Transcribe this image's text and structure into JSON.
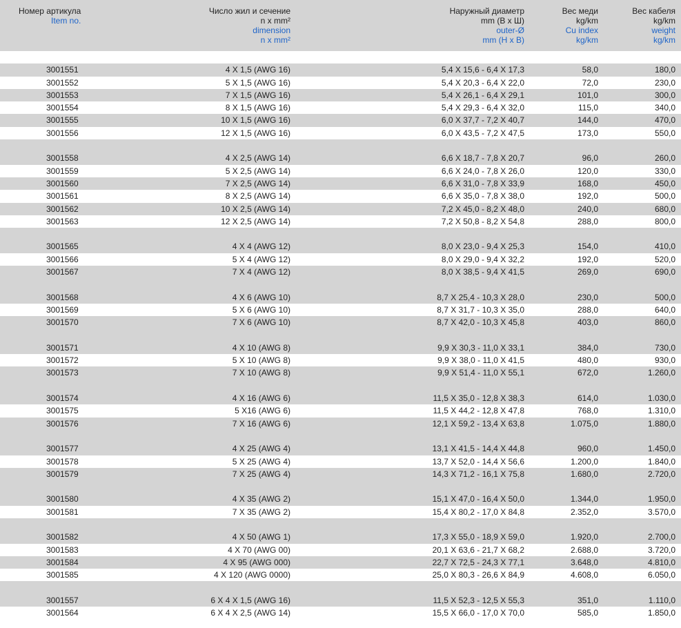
{
  "header": {
    "col1": {
      "ru": "Номер артикула",
      "en": "Item no."
    },
    "col2": {
      "ru1": "Число жил и сечение",
      "ru2": "n x mm²",
      "en1": "dimension",
      "en2": "n x mm²"
    },
    "col3": {
      "ru1": "Наружный диаметр",
      "ru2": "mm (В x Ш)",
      "en1": "outer-Ø",
      "en2": "mm (H x B)"
    },
    "col4": {
      "ru1": "Вес меди",
      "ru2": "kg/km",
      "en1": "Cu index",
      "en2": "kg/km"
    },
    "col5": {
      "ru1": "Вес кабеля",
      "ru2": "kg/km",
      "en1": "weight",
      "en2": "kg/km"
    }
  },
  "colors": {
    "stripe": "#d4d4d4",
    "accent_blue": "#1e64c8"
  },
  "groups": [
    [
      [
        "3001551",
        "4 X 1,5 (AWG 16)",
        "5,4 X 15,6 - 6,4 X 17,3",
        "58,0",
        "180,0"
      ],
      [
        "3001552",
        "5 X 1,5 (AWG 16)",
        "5,4 X 20,3 - 6,4 X 22,0",
        "72,0",
        "230,0"
      ],
      [
        "3001553",
        "7 X 1,5 (AWG 16)",
        "5,4 X 26,1 - 6,4 X 29,1",
        "101,0",
        "300,0"
      ],
      [
        "3001554",
        "8 X 1,5 (AWG 16)",
        "5,4 X 29,3 - 6,4 X 32,0",
        "115,0",
        "340,0"
      ],
      [
        "3001555",
        "10 X 1,5 (AWG 16)",
        "6,0 X 37,7 - 7,2 X 40,7",
        "144,0",
        "470,0"
      ],
      [
        "3001556",
        "12 X 1,5 (AWG 16)",
        "6,0 X 43,5 - 7,2 X 47,5",
        "173,0",
        "550,0"
      ]
    ],
    [
      [
        "3001558",
        "4 X 2,5 (AWG 14)",
        "6,6 X 18,7 - 7,8 X 20,7",
        "96,0",
        "260,0"
      ],
      [
        "3001559",
        "5 X 2,5 (AWG 14)",
        "6,6 X 24,0 - 7,8 X 26,0",
        "120,0",
        "330,0"
      ],
      [
        "3001560",
        "7 X 2,5 (AWG 14)",
        "6,6 X 31,0 - 7,8 X 33,9",
        "168,0",
        "450,0"
      ],
      [
        "3001561",
        "8 X 2,5 (AWG 14)",
        "6,6 X 35,0 - 7,8 X 38,0",
        "192,0",
        "500,0"
      ],
      [
        "3001562",
        "10 X 2,5 (AWG 14)",
        "7,2 X 45,0 - 8,2 X 48,0",
        "240,0",
        "680,0"
      ],
      [
        "3001563",
        "12 X 2,5 (AWG 14)",
        "7,2 X 50,8 - 8,2 X 54,8",
        "288,0",
        "800,0"
      ]
    ],
    [
      [
        "3001565",
        "4 X 4 (AWG 12)",
        "8,0 X 23,0 - 9,4 X 25,3",
        "154,0",
        "410,0"
      ],
      [
        "3001566",
        "5 X 4 (AWG 12)",
        "8,0 X 29,0 - 9,4 X 32,2",
        "192,0",
        "520,0"
      ],
      [
        "3001567",
        "7 X 4 (AWG 12)",
        "8,0 X 38,5 - 9,4 X 41,5",
        "269,0",
        "690,0"
      ]
    ],
    [
      [
        "3001568",
        "4 X 6 (AWG 10)",
        "8,7 X 25,4 - 10,3 X 28,0",
        "230,0",
        "500,0"
      ],
      [
        "3001569",
        "5 X 6 (AWG 10)",
        "8,7 X 31,7 - 10,3 X 35,0",
        "288,0",
        "640,0"
      ],
      [
        "3001570",
        "7 X 6 (AWG 10)",
        "8,7 X 42,0 - 10,3 X 45,8",
        "403,0",
        "860,0"
      ]
    ],
    [
      [
        "3001571",
        "4 X 10 (AWG 8)",
        "9,9 X 30,3 - 11,0 X 33,1",
        "384,0",
        "730,0"
      ],
      [
        "3001572",
        "5 X 10 (AWG 8)",
        "9,9 X 38,0 - 11,0 X 41,5",
        "480,0",
        "930,0"
      ],
      [
        "3001573",
        "7 X 10 (AWG 8)",
        "9,9 X 51,4 - 11,0 X 55,1",
        "672,0",
        "1.260,0"
      ]
    ],
    [
      [
        "3001574",
        "4 X 16 (AWG 6)",
        "11,5 X 35,0 - 12,8 X 38,3",
        "614,0",
        "1.030,0"
      ],
      [
        "3001575",
        "5 X16 (AWG 6)",
        "11,5 X 44,2 - 12,8 X 47,8",
        "768,0",
        "1.310,0"
      ],
      [
        "3001576",
        "7 X 16 (AWG 6)",
        "12,1 X 59,2 - 13,4 X 63,8",
        "1.075,0",
        "1.880,0"
      ]
    ],
    [
      [
        "3001577",
        "4 X 25 (AWG 4)",
        "13,1 X 41,5 - 14,4 X 44,8",
        "960,0",
        "1.450,0"
      ],
      [
        "3001578",
        "5 X 25 (AWG 4)",
        "13,7 X 52,0 - 14,4 X 56,6",
        "1.200,0",
        "1.840,0"
      ],
      [
        "3001579",
        "7 X 25 (AWG 4)",
        "14,3 X 71,2 - 16,1 X 75,8",
        "1.680,0",
        "2.720,0"
      ]
    ],
    [
      [
        "3001580",
        "4 X 35 (AWG 2)",
        "15,1 X 47,0 - 16,4 X 50,0",
        "1.344,0",
        "1.950,0"
      ],
      [
        "3001581",
        "7 X 35 (AWG 2)",
        "15,4 X 80,2 - 17,0 X 84,8",
        "2.352,0",
        "3.570,0"
      ]
    ],
    [
      [
        "3001582",
        "4 X 50 (AWG 1)",
        "17,3 X 55,0 - 18,9 X 59,0",
        "1.920,0",
        "2.700,0"
      ],
      [
        "3001583",
        "4 X 70 (AWG 00)",
        "20,1 X 63,6 - 21,7 X 68,2",
        "2.688,0",
        "3.720,0"
      ],
      [
        "3001584",
        "4 X 95 (AWG 000)",
        "22,7 X 72,5 - 24,3 X 77,1",
        "3.648,0",
        "4.810,0"
      ],
      [
        "3001585",
        "4 X 120 (AWG 0000)",
        "25,0 X 80,3 - 26,6 X 84,9",
        "4.608,0",
        "6.050,0"
      ]
    ],
    [
      [
        "3001557",
        "6 X 4 X 1,5 (AWG 16)",
        "11,5 X 52,3 - 12,5 X 55,3",
        "351,0",
        "1.110,0"
      ],
      [
        "3001564",
        "6 X 4 X 2,5 (AWG 14)",
        "15,5 X 66,0 - 17,0 X 70,0",
        "585,0",
        "1.850,0"
      ]
    ]
  ]
}
